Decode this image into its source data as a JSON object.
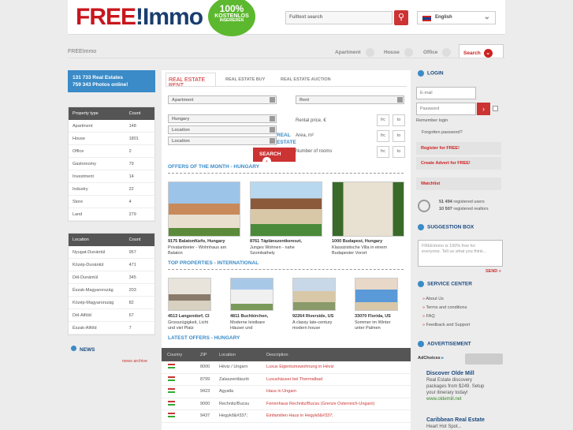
{
  "header": {
    "logo_a": "FREE",
    "logo_b": "!",
    "logo_c": "Immo",
    "badge_pct": "100%",
    "badge_l1": "KOSTENLOS",
    "badge_l2": "INSERIEREN",
    "search_placeholder": "Fulltext search",
    "lang": "English"
  },
  "nav": {
    "brand": "FREEImmo",
    "items": [
      "Apartment",
      "House",
      "Office"
    ],
    "active": "Search"
  },
  "stats": {
    "l1": "131 733  Real Estates",
    "l2": "759 343  Photos online!"
  },
  "property_table": {
    "h1": "Property type",
    "h2": "Count",
    "rows": [
      [
        "Apartment",
        "148"
      ],
      [
        "House",
        "1801"
      ],
      [
        "Office",
        "2"
      ],
      [
        "Gastronomy",
        "79"
      ],
      [
        "Investment",
        "14"
      ],
      [
        "Industry",
        "22"
      ],
      [
        "Store",
        "4"
      ],
      [
        "Land",
        "279"
      ]
    ]
  },
  "location_table": {
    "h1": "Location",
    "h2": "Count",
    "rows": [
      [
        "Nyugat-Dunántúl",
        "957"
      ],
      [
        "Közép-Dunántúl",
        "471"
      ],
      [
        "Dél-Dunántúl",
        "345"
      ],
      [
        "Észak-Magyarország",
        "203"
      ],
      [
        "Közép-Magyarország",
        "82"
      ],
      [
        "Dél-Alföld",
        "67"
      ],
      [
        "Észak-Alföld",
        "7"
      ]
    ]
  },
  "news": {
    "title": "NEWS",
    "archive": "news archive"
  },
  "tabs": [
    "REAL ESTATE RENT",
    "REAL ESTATE BUY",
    "REAL ESTATE AUCTION"
  ],
  "form": {
    "type": "Apartment",
    "deal": "Rent",
    "country": "Hungary",
    "loc1": "Location",
    "loc2": "Location",
    "price": "Rental price, €",
    "area": "Area, m²",
    "rooms": "Number of rooms",
    "from": "frc",
    "to": "to",
    "search": "SEARCH",
    "realest1": "REAL",
    "realest2": "ESTATE"
  },
  "offers_title": "OFFERS OF THE MONTH - HUNGARY",
  "offers": [
    {
      "t": "9175 Balatonfüzfo, Hungary",
      "d1": "Privatanbieter - Wohnhaus am",
      "d2": "Balaton"
    },
    {
      "t": "8761 Táplánszentkereszt,",
      "d1": "Junges Wohnen - nahe",
      "d2": "Szombathely"
    },
    {
      "t": "1000 Budapest, Hungary",
      "d1": "Klassizistische Villa in einem",
      "d2": "Budapester Vorort"
    }
  ],
  "top_title": "TOP PROPERTIES - INTERNATIONAL",
  "top": [
    {
      "t": "4513 Langendorf, CI",
      "d1": "Grosszügigkeit, Licht",
      "d2": "und viel Platz"
    },
    {
      "t": "4811 Buchkirchen,",
      "d1": "Moderne leistbare",
      "d2": "Häuser und"
    },
    {
      "t": "92264 Riverside, US",
      "d1": "A classy late-century",
      "d2": "modern house"
    },
    {
      "t": "33070 Florida, US",
      "d1": "Sommer im Winter",
      "d2": "unter Palmen"
    }
  ],
  "latest_title": "LATEST OFFERS - HUNGARY",
  "latest": {
    "h": [
      "Country",
      "ZIP",
      "Location",
      "Description"
    ],
    "rows": [
      [
        "8000",
        "Héviz / Ungarn",
        "Luxus Eigentumswohnung in Héviz"
      ],
      [
        "8799",
        "Zalaszentlászló",
        "Luxushäuser bei Thermalbad"
      ],
      [
        "9423",
        "Agyalla",
        "Haus in Ungarn"
      ],
      [
        "9000",
        "Rechnitz/Bucsu",
        "Ferienhaus Rechnitz/Bucsu (Grenze Österreich-Ungarn)"
      ],
      [
        "9437",
        "Hegykő&#337;",
        "Einfamilien Haus in Hegykő&#337;"
      ]
    ]
  },
  "login": {
    "title": "LOGIN",
    "email": "E-mail",
    "password": "Password",
    "remember": "Remember login",
    "forgot": "Forgotten password?",
    "register": "Register for FREE!",
    "advert": "Create Advert for FREE!",
    "watchlist": "Watchlist",
    "users_n": "51 494",
    "users_t": "registered users",
    "realtors_n": "10 507",
    "realtors_t": "registered realtors"
  },
  "suggest": {
    "title": "SUGGESTION BOX",
    "text1": "FREEimmo is 100% free for",
    "text2": "everyone. Tell us what you think...",
    "send": "SEND"
  },
  "service": {
    "title": "SERVICE CENTER",
    "items": [
      "About Us",
      "Terms and conditions",
      "FAQ",
      "Feedback and Support"
    ]
  },
  "advert": {
    "title": "ADVERTISEMENT",
    "adchoices": "AdChoices",
    "ad1_title": "Discover Olde Mill",
    "ad1_l1": "Real Estate discovery",
    "ad1_l2": "packages from $249. Setup",
    "ad1_l3": "your itinerary today!",
    "ad1_url": "www.oldemill.net",
    "ad2_title": "Caribbean Real Estate",
    "ad2_l1": "Heart Hot Spot..."
  }
}
